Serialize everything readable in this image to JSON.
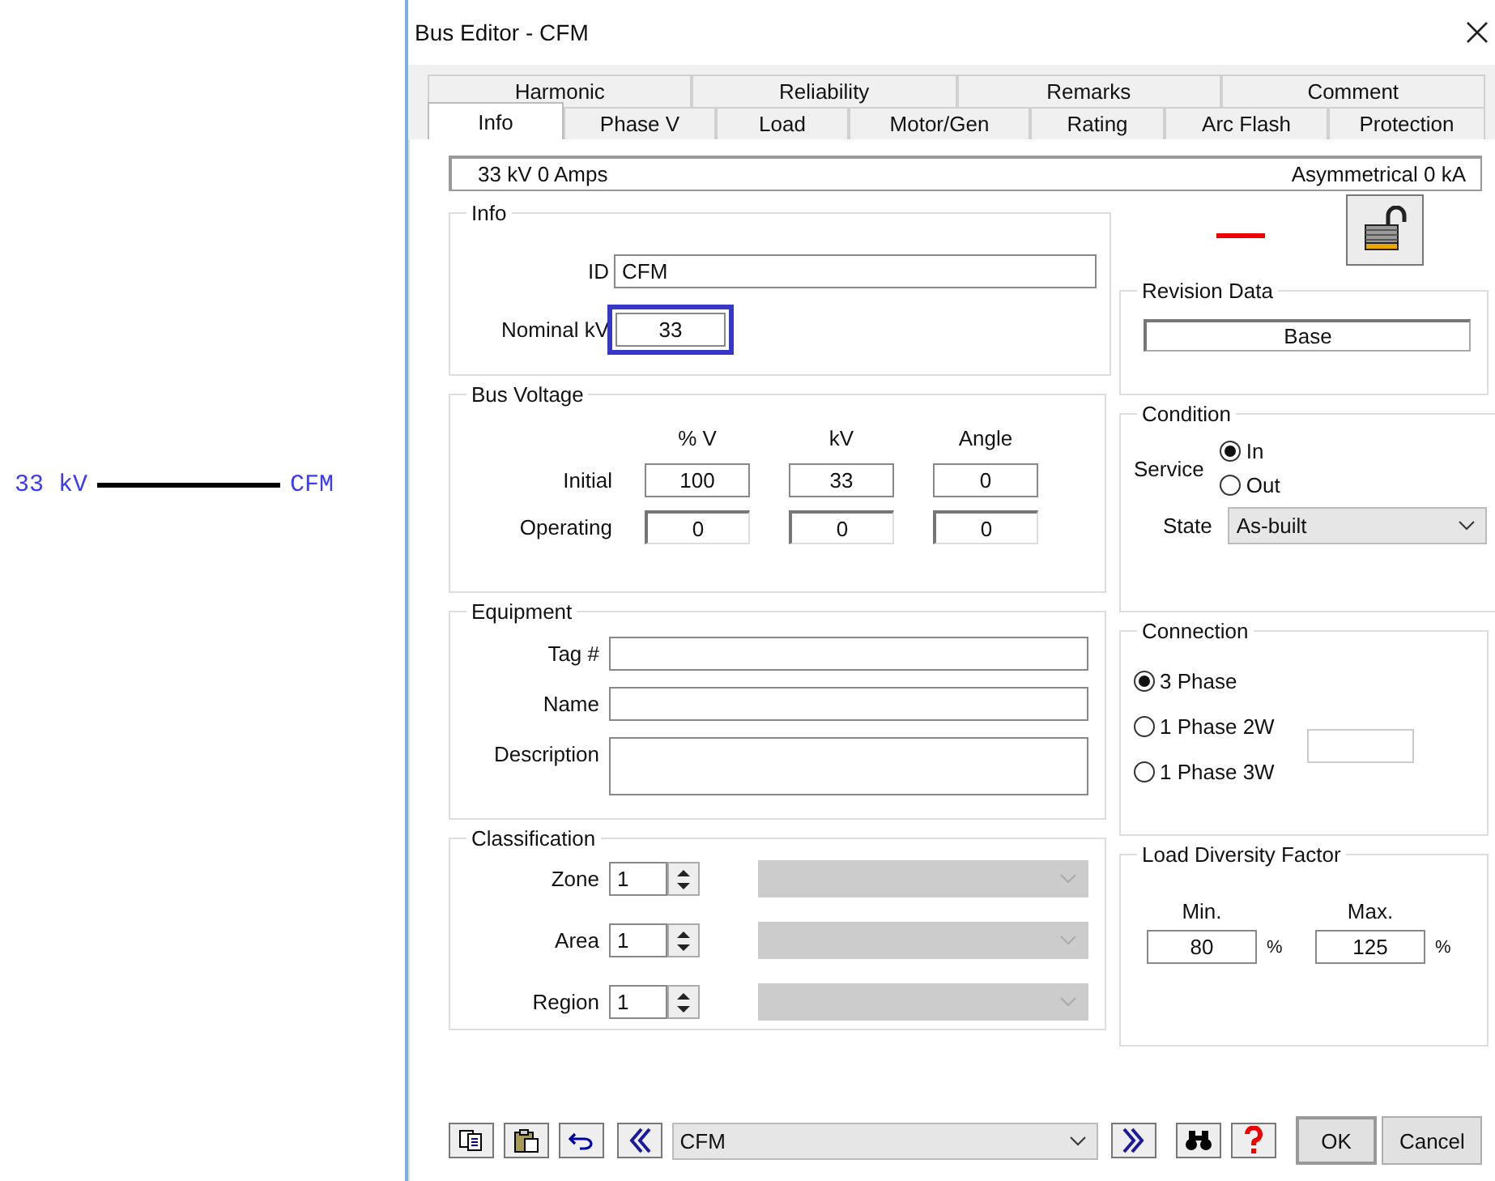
{
  "canvas": {
    "bus_voltage": "33 kV",
    "bus_id": "CFM"
  },
  "window": {
    "title": "Bus Editor - CFM"
  },
  "tabs_back": [
    {
      "label": "Harmonic",
      "selected": false
    },
    {
      "label": "Reliability",
      "selected": false
    },
    {
      "label": "Remarks",
      "selected": false
    },
    {
      "label": "Comment",
      "selected": false
    }
  ],
  "tabs_front": [
    {
      "label": "Info",
      "selected": true
    },
    {
      "label": "Phase V",
      "selected": false
    },
    {
      "label": "Load",
      "selected": false
    },
    {
      "label": "Motor/Gen",
      "selected": false
    },
    {
      "label": "Rating",
      "selected": false
    },
    {
      "label": "Arc Flash",
      "selected": false
    },
    {
      "label": "Protection",
      "selected": false
    }
  ],
  "status": {
    "left": "33 kV 0 Amps",
    "right": "Asymmetrical 0 kA"
  },
  "info": {
    "title": "Info",
    "id_label": "ID",
    "id_value": "CFM",
    "nominal_label": "Nominal kV",
    "nominal_value": "33"
  },
  "bus_voltage": {
    "title": "Bus Voltage",
    "columns": [
      "% V",
      "kV",
      "Angle"
    ],
    "rows": [
      {
        "label": "Initial",
        "kind": "editable",
        "values": [
          "100",
          "33",
          "0"
        ]
      },
      {
        "label": "Operating",
        "kind": "readonly",
        "values": [
          "0",
          "0",
          "0"
        ]
      }
    ]
  },
  "equipment": {
    "title": "Equipment",
    "fields": [
      {
        "label": "Tag #",
        "kind": "line"
      },
      {
        "label": "Name",
        "kind": "line"
      },
      {
        "label": "Description",
        "kind": "multiline"
      }
    ]
  },
  "classification": {
    "title": "Classification",
    "rows": [
      {
        "label": "Zone",
        "value": "1"
      },
      {
        "label": "Area",
        "value": "1"
      },
      {
        "label": "Region",
        "value": "1"
      }
    ]
  },
  "revision": {
    "title": "Revision Data",
    "value": "Base"
  },
  "condition": {
    "title": "Condition",
    "service_label": "Service",
    "options": [
      {
        "label": "In",
        "selected": true
      },
      {
        "label": "Out",
        "selected": false
      }
    ],
    "state_label": "State",
    "state_value": "As-built"
  },
  "connection": {
    "title": "Connection",
    "options": [
      {
        "label": "3 Phase",
        "selected": true
      },
      {
        "label": "1 Phase 2W",
        "selected": false
      },
      {
        "label": "1 Phase 3W",
        "selected": false
      }
    ]
  },
  "load_diversity": {
    "title": "Load Diversity Factor",
    "min_label": "Min.",
    "min_value": "80",
    "min_unit": "%",
    "max_label": "Max.",
    "max_value": "125",
    "max_unit": "%"
  },
  "footer": {
    "selector": "CFM",
    "ok": "OK",
    "cancel": "Cancel"
  }
}
